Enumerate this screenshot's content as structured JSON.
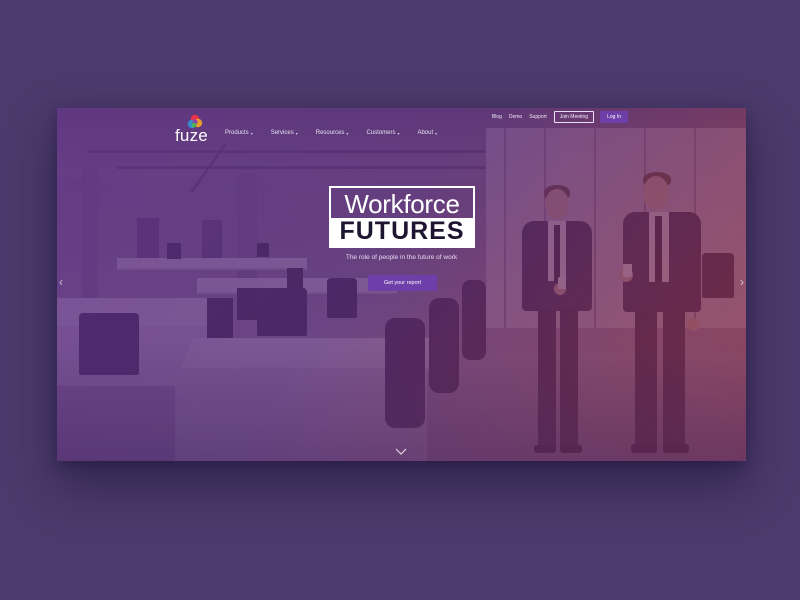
{
  "brand": {
    "logo_text": "fuze",
    "logo_colors": [
      "#e8334a",
      "#f6a623",
      "#4cb848",
      "#2a9fd8",
      "#8e3fb0"
    ]
  },
  "utility_nav": {
    "links": [
      "Blog",
      "Demo",
      "Support"
    ],
    "join_meeting": "Join Meeting",
    "login": "Log In"
  },
  "main_nav": {
    "items": [
      "Products",
      "Services",
      "Resources",
      "Customers",
      "About"
    ]
  },
  "hero": {
    "title_line_1": "Workforce",
    "title_line_2": "FUTURES",
    "subtitle": "The role of people in the future of work",
    "cta": "Get your report"
  },
  "icons": {
    "prev": "chevron-left-icon",
    "next": "chevron-right-icon",
    "scroll": "chevron-down-icon"
  },
  "colors": {
    "page_background": "#4b3a6b",
    "accent_purple": "#6e3fa8",
    "overlay_purple": "#5c2d82",
    "overlay_red": "#872d46"
  }
}
